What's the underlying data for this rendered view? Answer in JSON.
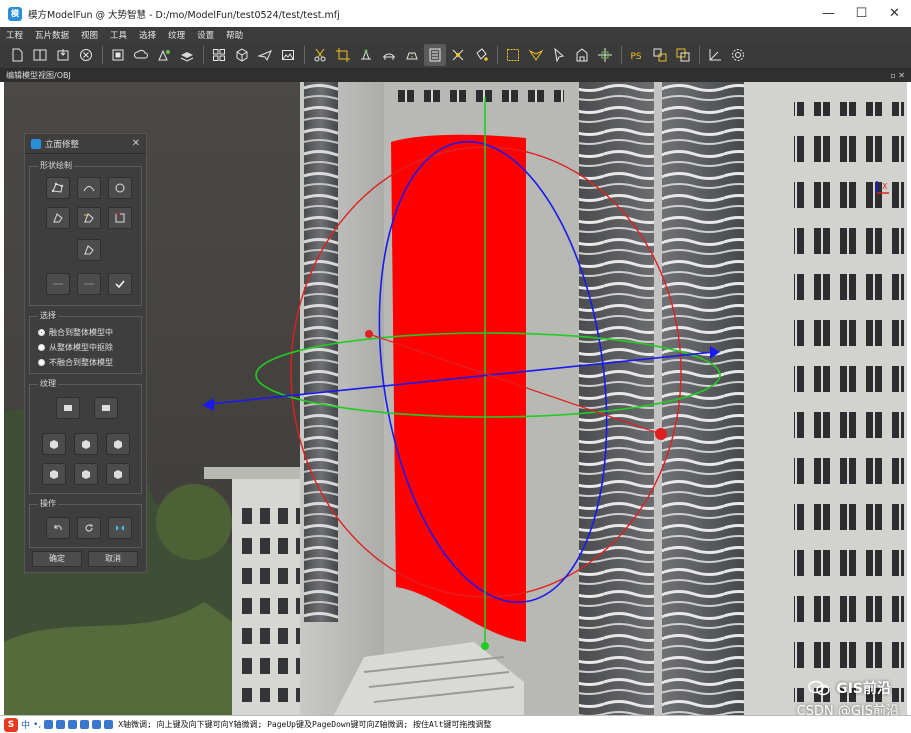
{
  "window": {
    "logo": "模",
    "title": "模方ModelFun @ 大势智慧 - D:/mo/ModelFun/test0524/test/test.mfj",
    "controls": [
      "minimize-icon",
      "maximize-icon",
      "close-icon"
    ],
    "minimize_glyph": "—",
    "maximize_glyph": "☐",
    "close_glyph": "✕"
  },
  "menu": [
    "工程",
    "瓦片数据",
    "视图",
    "工具",
    "选择",
    "纹理",
    "设置",
    "帮助"
  ],
  "toolbar": {
    "groups": [
      [
        "new-file-icon",
        "split-view-icon",
        "import-icon",
        "close-project-icon"
      ],
      [
        "stop-icon",
        "cloud-icon",
        "model-edit-icon",
        "layers-icon"
      ],
      [
        "grid-icon",
        "cube-icon",
        "plane-icon",
        "image-icon"
      ],
      [
        "cut-icon",
        "crop-icon",
        "flatten-icon",
        "bridge-icon",
        "road-icon",
        "facade-icon",
        "repair-icon",
        "fill-icon"
      ],
      [
        "select-rect-icon",
        "select-lasso-icon",
        "select-pointer-icon",
        "building-icon",
        "move-gizmo-icon"
      ],
      [
        "photoshop-icon",
        "texture-swap-icon",
        "texture-copy-icon"
      ],
      [
        "measure-icon",
        "settings-icon"
      ]
    ],
    "ps_label": "PS",
    "active_tool": "facade-icon"
  },
  "viewport": {
    "header": "编辑模型视图/OBJ",
    "header_icons": "▫ ✕"
  },
  "panel": {
    "title": "立面修整",
    "close_glyph": "✕",
    "shape_group": {
      "label": "形状绘制",
      "buttons": [
        "polygon-draw-icon",
        "arc-draw-icon",
        "circle-draw-icon",
        "shape-add-icon",
        "shape-subtract-icon",
        "rectangle-draw-icon",
        "shape-edit-icon",
        "undo-point-icon",
        "redo-point-icon",
        "confirm-check-icon"
      ]
    },
    "select_group": {
      "label": "选择",
      "options": [
        "融合到整体模型中",
        "从整体模型中抠除",
        "不融合到整体模型"
      ],
      "selected_index": 0
    },
    "texture_group": {
      "label": "纹理",
      "buttons": [
        "texture-flat-icon",
        "texture-flat-alt-icon",
        "box-texture-1-icon",
        "box-texture-2-icon",
        "box-texture-3-icon",
        "box-texture-4-icon",
        "box-texture-5-icon",
        "box-texture-6-icon"
      ]
    },
    "operate_group": {
      "label": "操作",
      "buttons": [
        "undo-icon",
        "rotate-icon",
        "mirror-icon"
      ]
    },
    "ok_label": "确定",
    "cancel_label": "取消"
  },
  "watermark": {
    "brand": "GIS前沿",
    "source": "CSDN @GIS前沿"
  },
  "statusbar": {
    "ime_logo": "S",
    "ime_mode": "中",
    "ime_punct": "•,",
    "message": "X轴微调; 向上键及向下键可向Y轴微调; PageUp键及PageDown键可向Z轴微调; 按住Alt键可拖拽调整"
  },
  "colors": {
    "facade_fill": "#ff0000",
    "ring_red": "#e02020",
    "ring_green": "#22cc22",
    "ring_blue": "#1a1aee",
    "accent": "#2b8fd8"
  }
}
